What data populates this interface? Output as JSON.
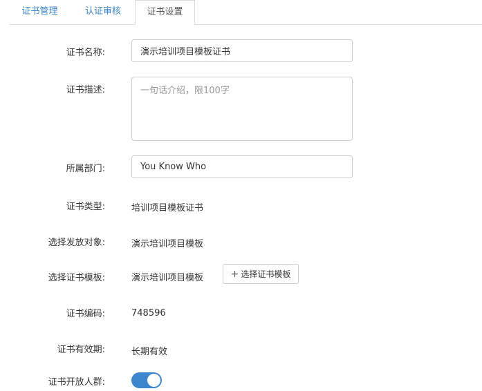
{
  "tabs": [
    {
      "label": "证书管理",
      "active": false
    },
    {
      "label": "认证审核",
      "active": false
    },
    {
      "label": "证书设置",
      "active": true
    }
  ],
  "form": {
    "name": {
      "label": "证书名称:",
      "value": "演示培训项目模板证书"
    },
    "description": {
      "label": "证书描述:",
      "value": "",
      "placeholder": "一句话介绍，限100字"
    },
    "department": {
      "label": "所属部门:",
      "value": "You Know Who"
    },
    "type": {
      "label": "证书类型:",
      "value": "培训项目模板证书"
    },
    "target": {
      "label": "选择发放对象:",
      "value": "演示培训项目模板"
    },
    "template": {
      "label": "选择证书模板:",
      "value": "演示培训项目模板",
      "button_label": "选择证书模板"
    },
    "code": {
      "label": "证书编码:",
      "value": "748596"
    },
    "validity": {
      "label": "证书有效期:",
      "value": "长期有效"
    },
    "open_group": {
      "label": "证书开放人群:",
      "enabled": true
    }
  },
  "colors": {
    "accent": "#3b86cd",
    "tab_link": "#3a86c8"
  }
}
